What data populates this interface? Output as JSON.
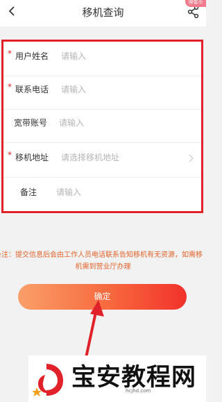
{
  "header": {
    "title": "移机查询",
    "back_icon": "chevron-left-icon",
    "share_icon": "share-icon",
    "corner_badge": "得金币"
  },
  "form": {
    "rows": [
      {
        "label": "用户姓名",
        "required": true,
        "placeholder": "请输入",
        "has_chevron": false
      },
      {
        "label": "联系电话",
        "required": true,
        "placeholder": "请输入",
        "has_chevron": false
      },
      {
        "label": "宽带账号",
        "required": false,
        "placeholder": "请输入",
        "has_chevron": false
      },
      {
        "label": "移机地址",
        "required": true,
        "placeholder": "请选择移机地址",
        "has_chevron": true
      },
      {
        "label": "备注",
        "required": false,
        "placeholder": "请输入",
        "has_chevron": false
      }
    ],
    "required_mark": "*",
    "highlight_color": "#e2222a"
  },
  "note": {
    "line1": "备注：提交信息后会由工作人员电话联系告知移机有无资源，如需移",
    "line2": "机需到营业厅办理",
    "color": "#e2622a"
  },
  "confirm_button": {
    "label": "确定",
    "gradient": [
      "#fa9f6a",
      "#f2322c"
    ]
  },
  "annotation": {
    "arrow_color": "#e2222a"
  },
  "watermark": {
    "title": "宝安教程网",
    "domain": "hcjhd.com"
  }
}
